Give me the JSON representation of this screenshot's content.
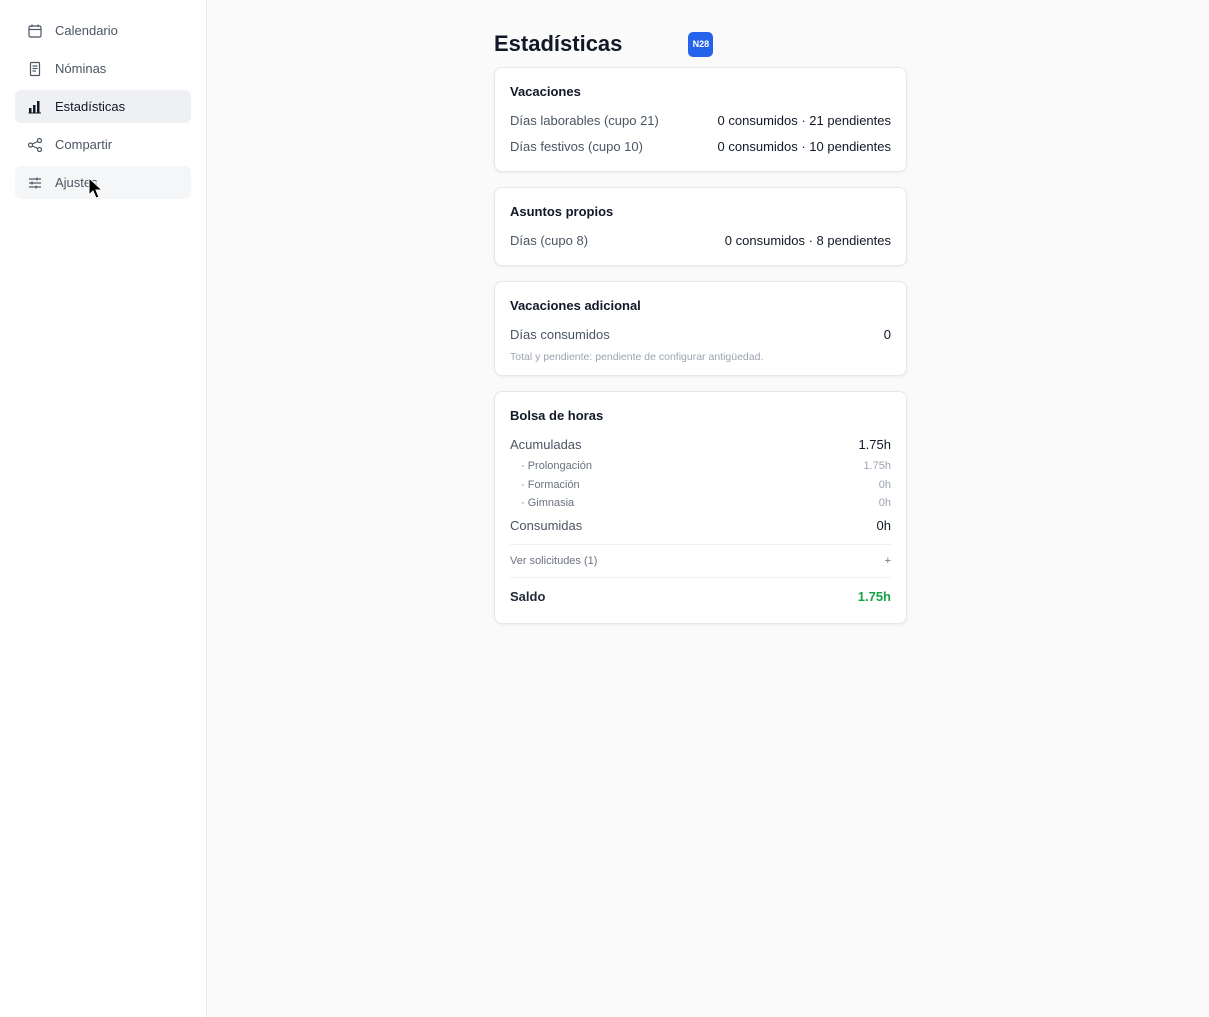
{
  "sidebar": {
    "items": [
      {
        "label": "Calendario",
        "icon": "calendar-icon"
      },
      {
        "label": "Nóminas",
        "icon": "document-icon"
      },
      {
        "label": "Estadísticas",
        "icon": "bar-chart-icon"
      },
      {
        "label": "Compartir",
        "icon": "share-icon"
      },
      {
        "label": "Ajustes",
        "icon": "sliders-icon"
      }
    ]
  },
  "header": {
    "title": "Estadísticas",
    "badge": "N28"
  },
  "cards": {
    "vacaciones": {
      "title": "Vacaciones",
      "rows": [
        {
          "label": "Días laborables (cupo 21)",
          "value": "0 consumidos · 21 pendientes"
        },
        {
          "label": "Días festivos (cupo 10)",
          "value": "0 consumidos · 10 pendientes"
        }
      ]
    },
    "asuntos": {
      "title": "Asuntos propios",
      "rows": [
        {
          "label": "Días (cupo 8)",
          "value": "0 consumidos · 8 pendientes"
        }
      ]
    },
    "adicional": {
      "title": "Vacaciones adicional",
      "rows": [
        {
          "label": "Días consumidos",
          "value": "0"
        }
      ],
      "note": "Total y pendiente: pendiente de configurar antigüedad."
    },
    "bolsa": {
      "title": "Bolsa de horas",
      "acumuladas": {
        "label": "Acumuladas",
        "value": "1.75h"
      },
      "sub": [
        {
          "label": "· Prolongación",
          "value": "1.75h"
        },
        {
          "label": "· Formación",
          "value": "0h"
        },
        {
          "label": "· Gimnasia",
          "value": "0h"
        }
      ],
      "consumidas": {
        "label": "Consumidas",
        "value": "0h"
      },
      "link": {
        "label": "Ver solicitudes (1)",
        "toggle": "+"
      },
      "saldo": {
        "label": "Saldo",
        "value": "1.75h"
      }
    }
  },
  "colors": {
    "accent": "#2563eb",
    "positive": "#16a34a"
  }
}
